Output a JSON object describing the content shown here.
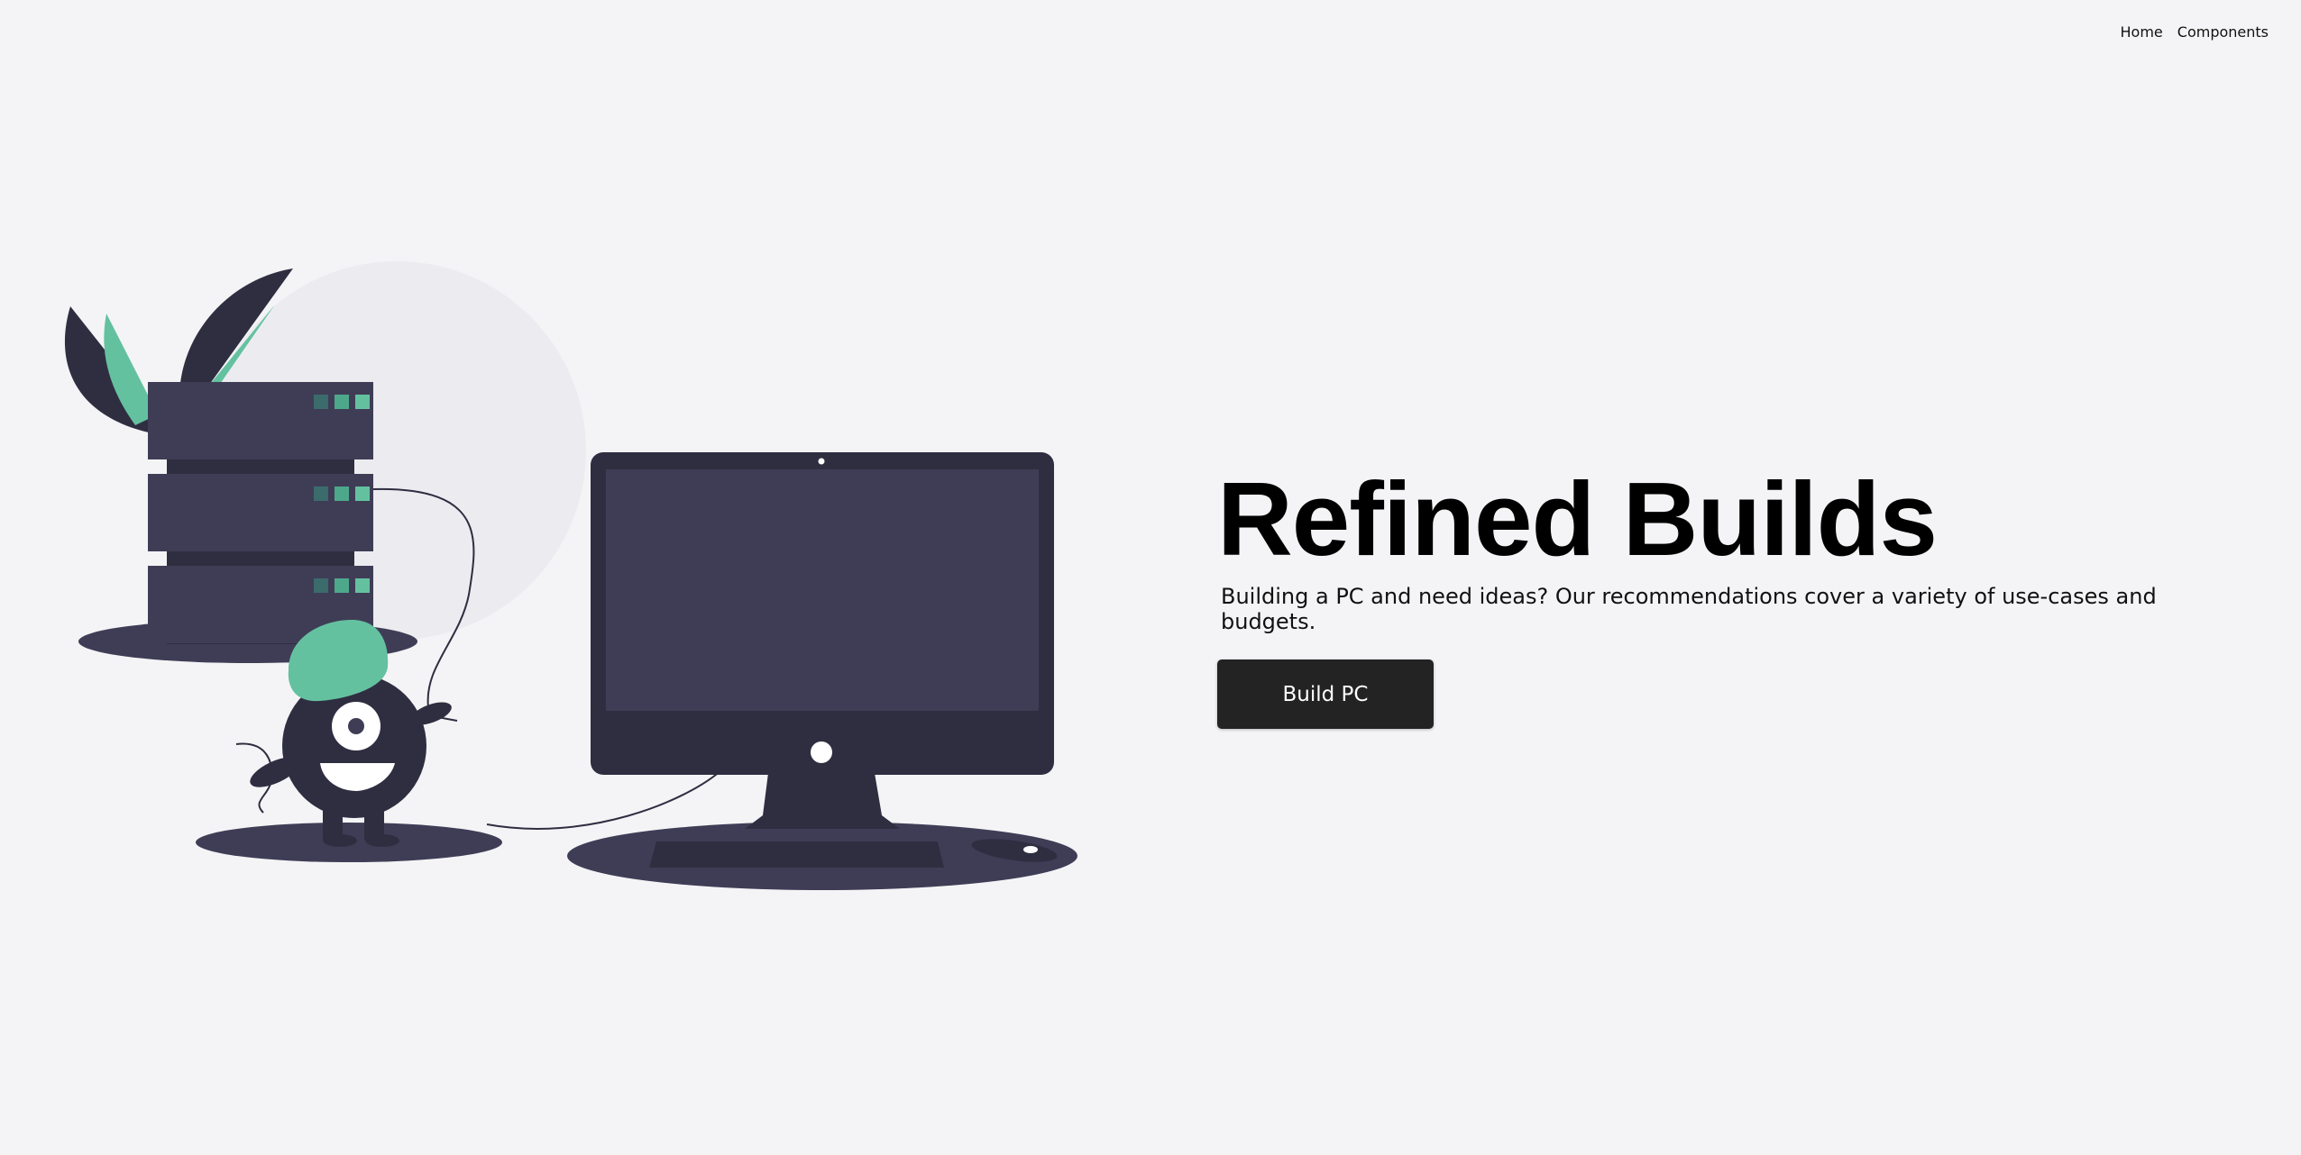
{
  "nav": {
    "items": [
      {
        "label": "Home"
      },
      {
        "label": "Components"
      }
    ]
  },
  "hero": {
    "title": "Refined Builds",
    "subtitle": "Building a PC and need ideas? Our recommendations cover a variety of use-cases and budgets.",
    "cta_label": "Build PC"
  },
  "colors": {
    "background": "#f4f4f6",
    "illustration_dark": "#2f2e41",
    "illustration_purple": "#3f3d56",
    "accent_green": "#64c1a0",
    "button": "#232323"
  },
  "icons": {
    "illustration": "monster-with-server-and-monitor-illustration"
  }
}
